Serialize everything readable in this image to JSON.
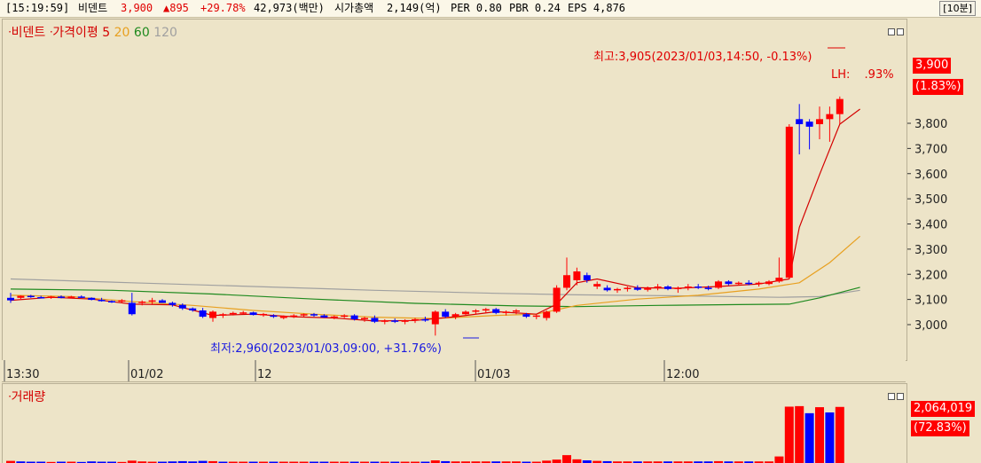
{
  "header": {
    "time": "[15:19:59]",
    "name": "비덴트",
    "price": "3,900",
    "change": "▲895",
    "change_pct": "+29.78%",
    "volume": "42,973(백만)",
    "mcap_label": "시가총액",
    "mcap_value": "2,149(억)",
    "per": "PER 0.80",
    "pbr": "PBR 0.24",
    "eps": "EPS 4,876",
    "interval": "[10분]"
  },
  "legend": {
    "name": "비덴트",
    "ma_label": "가격이평",
    "ma5": "5",
    "ma20": "20",
    "ma60": "60",
    "ma120": "120"
  },
  "annotations": {
    "high": "최고:3,905(2023/01/03,14:50, -0.13%)",
    "low": "최저:2,960(2023/01/03,09:00, +31.76%)",
    "lh": "LH:",
    "lh_pct": ".93%"
  },
  "price_tags": {
    "price": "3,900",
    "pct": "(1.83%)"
  },
  "volume_panel": {
    "title": "거래량",
    "value": "2,064,019",
    "pct": "(72.83%)"
  },
  "colors": {
    "up": "#ff0000",
    "down": "#0000ff",
    "ma5": "#d40000",
    "ma20": "#e8a020",
    "ma60": "#1f8a1f",
    "ma120": "#a0a0a0"
  },
  "chart_data": {
    "type": "candlestick",
    "y_ticks": [
      "3,800",
      "3,700",
      "3,600",
      "3,500",
      "3,400",
      "3,300",
      "3,200",
      "3,100",
      "3,000"
    ],
    "x_ticks": [
      "13:30",
      "01/02",
      "12",
      "01/03",
      "12:00"
    ],
    "candles": [
      [
        3110,
        3130,
        3090,
        3100
      ],
      [
        3110,
        3120,
        3105,
        3118
      ],
      [
        3118,
        3122,
        3110,
        3113
      ],
      [
        3113,
        3118,
        3108,
        3110
      ],
      [
        3110,
        3118,
        3106,
        3115
      ],
      [
        3115,
        3120,
        3108,
        3112
      ],
      [
        3112,
        3118,
        3108,
        3115
      ],
      [
        3115,
        3120,
        3110,
        3110
      ],
      [
        3110,
        3112,
        3100,
        3102
      ],
      [
        3102,
        3110,
        3095,
        3097
      ],
      [
        3097,
        3100,
        3090,
        3095
      ],
      [
        3095,
        3105,
        3090,
        3100
      ],
      [
        3090,
        3130,
        3040,
        3045
      ],
      [
        3090,
        3100,
        3080,
        3095
      ],
      [
        3095,
        3110,
        3085,
        3100
      ],
      [
        3100,
        3105,
        3090,
        3090
      ],
      [
        3090,
        3095,
        3075,
        3082
      ],
      [
        3082,
        3088,
        3062,
        3068
      ],
      [
        3068,
        3072,
        3055,
        3060
      ],
      [
        3060,
        3070,
        3030,
        3035
      ],
      [
        3030,
        3060,
        3015,
        3055
      ],
      [
        3040,
        3050,
        3030,
        3045
      ],
      [
        3045,
        3055,
        3040,
        3050
      ],
      [
        3050,
        3058,
        3045,
        3052
      ],
      [
        3052,
        3055,
        3040,
        3042
      ],
      [
        3042,
        3050,
        3035,
        3046
      ],
      [
        3040,
        3045,
        3030,
        3035
      ],
      [
        3030,
        3040,
        3025,
        3038
      ],
      [
        3038,
        3045,
        3030,
        3040
      ],
      [
        3040,
        3048,
        3035,
        3045
      ],
      [
        3045,
        3050,
        3035,
        3040
      ],
      [
        3040,
        3045,
        3030,
        3032
      ],
      [
        3032,
        3040,
        3025,
        3036
      ],
      [
        3036,
        3045,
        3030,
        3040
      ],
      [
        3040,
        3045,
        3020,
        3025
      ],
      [
        3025,
        3035,
        3015,
        3030
      ],
      [
        3030,
        3040,
        3010,
        3015
      ],
      [
        3015,
        3025,
        3005,
        3020
      ],
      [
        3020,
        3028,
        3010,
        3015
      ],
      [
        3015,
        3025,
        3005,
        3020
      ],
      [
        3020,
        3030,
        3010,
        3025
      ],
      [
        3025,
        3035,
        3015,
        3020
      ],
      [
        3005,
        3060,
        2960,
        3055
      ],
      [
        3055,
        3065,
        3030,
        3035
      ],
      [
        3035,
        3050,
        3025,
        3045
      ],
      [
        3045,
        3060,
        3040,
        3055
      ],
      [
        3055,
        3065,
        3045,
        3060
      ],
      [
        3060,
        3070,
        3050,
        3065
      ],
      [
        3065,
        3070,
        3045,
        3050
      ],
      [
        3050,
        3060,
        3040,
        3055
      ],
      [
        3055,
        3065,
        3045,
        3060
      ],
      [
        3045,
        3050,
        3030,
        3035
      ],
      [
        3035,
        3045,
        3025,
        3040
      ],
      [
        3030,
        3060,
        3020,
        3055
      ],
      [
        3055,
        3160,
        3050,
        3150
      ],
      [
        3150,
        3270,
        3140,
        3200
      ],
      [
        3180,
        3230,
        3160,
        3215
      ],
      [
        3200,
        3210,
        3170,
        3180
      ],
      [
        3155,
        3175,
        3145,
        3165
      ],
      [
        3150,
        3160,
        3135,
        3140
      ],
      [
        3140,
        3150,
        3130,
        3145
      ],
      [
        3145,
        3155,
        3135,
        3150
      ],
      [
        3150,
        3160,
        3138,
        3142
      ],
      [
        3142,
        3155,
        3135,
        3150
      ],
      [
        3150,
        3165,
        3140,
        3155
      ],
      [
        3155,
        3160,
        3140,
        3145
      ],
      [
        3145,
        3155,
        3130,
        3150
      ],
      [
        3150,
        3165,
        3140,
        3155
      ],
      [
        3155,
        3165,
        3145,
        3150
      ],
      [
        3150,
        3158,
        3140,
        3145
      ],
      [
        3150,
        3180,
        3145,
        3175
      ],
      [
        3175,
        3180,
        3160,
        3165
      ],
      [
        3165,
        3175,
        3160,
        3170
      ],
      [
        3170,
        3180,
        3160,
        3165
      ],
      [
        3165,
        3175,
        3155,
        3170
      ],
      [
        3165,
        3180,
        3160,
        3175
      ],
      [
        3175,
        3270,
        3170,
        3190
      ],
      [
        3190,
        3800,
        3185,
        3790
      ],
      [
        3820,
        3880,
        3680,
        3800
      ],
      [
        3810,
        3820,
        3700,
        3790
      ],
      [
        3800,
        3870,
        3740,
        3820
      ],
      [
        3820,
        3870,
        3730,
        3840
      ],
      [
        3840,
        3910,
        3800,
        3900
      ]
    ],
    "ma5": [
      [
        0,
        3100
      ],
      [
        4,
        3112
      ],
      [
        8,
        3105
      ],
      [
        12,
        3085
      ],
      [
        16,
        3082
      ],
      [
        20,
        3040
      ],
      [
        24,
        3045
      ],
      [
        28,
        3035
      ],
      [
        32,
        3030
      ],
      [
        36,
        3018
      ],
      [
        40,
        3020
      ],
      [
        44,
        3035
      ],
      [
        48,
        3055
      ],
      [
        52,
        3045
      ],
      [
        54,
        3085
      ],
      [
        56,
        3170
      ],
      [
        58,
        3185
      ],
      [
        62,
        3150
      ],
      [
        66,
        3148
      ],
      [
        70,
        3155
      ],
      [
        74,
        3165
      ],
      [
        77,
        3185
      ],
      [
        78,
        3390
      ],
      [
        80,
        3600
      ],
      [
        82,
        3800
      ],
      [
        84,
        3860
      ]
    ],
    "ma20": [
      [
        0,
        3120
      ],
      [
        6,
        3115
      ],
      [
        12,
        3095
      ],
      [
        18,
        3080
      ],
      [
        24,
        3060
      ],
      [
        30,
        3045
      ],
      [
        36,
        3033
      ],
      [
        42,
        3028
      ],
      [
        48,
        3040
      ],
      [
        52,
        3045
      ],
      [
        56,
        3080
      ],
      [
        62,
        3105
      ],
      [
        68,
        3120
      ],
      [
        74,
        3145
      ],
      [
        78,
        3170
      ],
      [
        81,
        3250
      ],
      [
        84,
        3355
      ]
    ],
    "ma60": [
      [
        0,
        3145
      ],
      [
        10,
        3140
      ],
      [
        20,
        3125
      ],
      [
        30,
        3105
      ],
      [
        40,
        3088
      ],
      [
        50,
        3078
      ],
      [
        56,
        3075
      ],
      [
        64,
        3080
      ],
      [
        72,
        3083
      ],
      [
        77,
        3085
      ],
      [
        80,
        3110
      ],
      [
        84,
        3152
      ]
    ],
    "ma120": [
      [
        0,
        3185
      ],
      [
        12,
        3170
      ],
      [
        24,
        3155
      ],
      [
        36,
        3140
      ],
      [
        48,
        3128
      ],
      [
        56,
        3122
      ],
      [
        66,
        3118
      ],
      [
        76,
        3112
      ],
      [
        80,
        3115
      ],
      [
        84,
        3140
      ]
    ],
    "volume": [
      8,
      6,
      5,
      5,
      4,
      5,
      5,
      4,
      6,
      5,
      5,
      4,
      9,
      6,
      5,
      5,
      6,
      7,
      6,
      8,
      7,
      5,
      5,
      5,
      5,
      5,
      5,
      5,
      5,
      5,
      5,
      5,
      5,
      5,
      5,
      5,
      5,
      5,
      5,
      5,
      5,
      5,
      10,
      7,
      6,
      6,
      6,
      6,
      6,
      6,
      6,
      5,
      5,
      9,
      13,
      30,
      14,
      10,
      8,
      7,
      6,
      6,
      6,
      6,
      6,
      6,
      6,
      6,
      6,
      6,
      7,
      6,
      6,
      6,
      6,
      6,
      25,
      215,
      217,
      190,
      213,
      193,
      214
    ],
    "volume_up": [
      1,
      0,
      0,
      0,
      1,
      0,
      1,
      0,
      0,
      0,
      0,
      1,
      1,
      1,
      1,
      0,
      0,
      0,
      0,
      0,
      1,
      0,
      1,
      1,
      0,
      1,
      0,
      1,
      1,
      1,
      0,
      0,
      1,
      1,
      0,
      1,
      0,
      1,
      0,
      1,
      1,
      0,
      1,
      0,
      1,
      1,
      1,
      1,
      0,
      1,
      1,
      0,
      1,
      1,
      1,
      1,
      1,
      0,
      1,
      0,
      1,
      1,
      0,
      1,
      1,
      0,
      1,
      1,
      0,
      0,
      1,
      0,
      1,
      0,
      1,
      1,
      1,
      1,
      1,
      0,
      1,
      0,
      1
    ]
  }
}
